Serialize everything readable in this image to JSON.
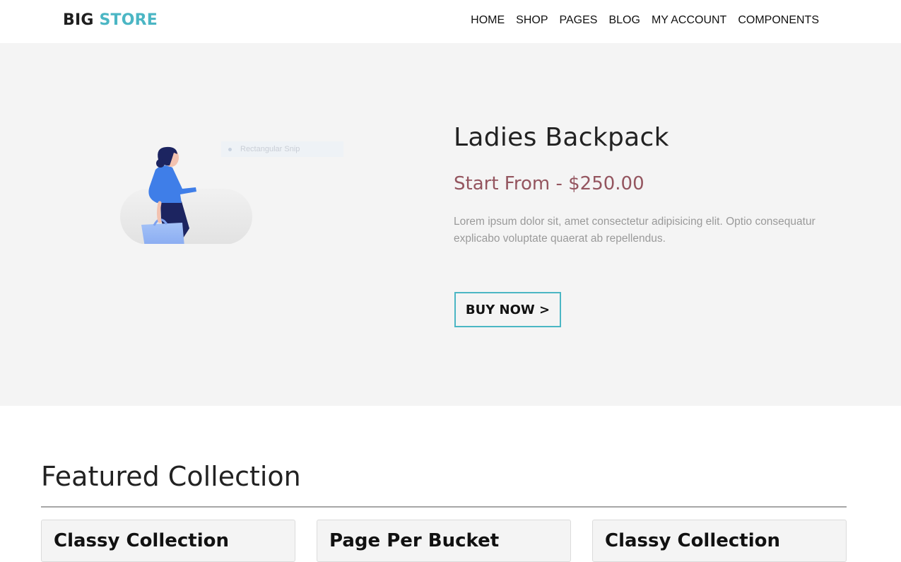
{
  "brand": {
    "logo_part1": "BIG",
    "logo_part2": "STORE"
  },
  "nav": {
    "items": [
      "HOME",
      "SHOP",
      "PAGES",
      "BLOG",
      "MY ACCOUNT",
      "COMPONENTS"
    ]
  },
  "hero": {
    "title": "Ladies Backpack",
    "price": "Start From - $250.00",
    "description": "Lorem ipsum dolor sit, amet consectetur adipisicing elit. Optio consequatur explicabo voluptate quaerat ab repellendus.",
    "cta_label": "BUY NOW >",
    "snip_label": "Rectangular Snip"
  },
  "featured": {
    "title": "Featured Collection",
    "cards": [
      {
        "title": "Classy Collection"
      },
      {
        "title": "Page Per Bucket"
      },
      {
        "title": "Classy Collection"
      }
    ]
  },
  "colors": {
    "accent": "#4bb6c4",
    "price": "#94555f",
    "hero_bg": "#f4f4f4",
    "figure_shirt": "#3f7ee8",
    "figure_pants": "#1c2460",
    "figure_bag": "#8fb2f5"
  }
}
